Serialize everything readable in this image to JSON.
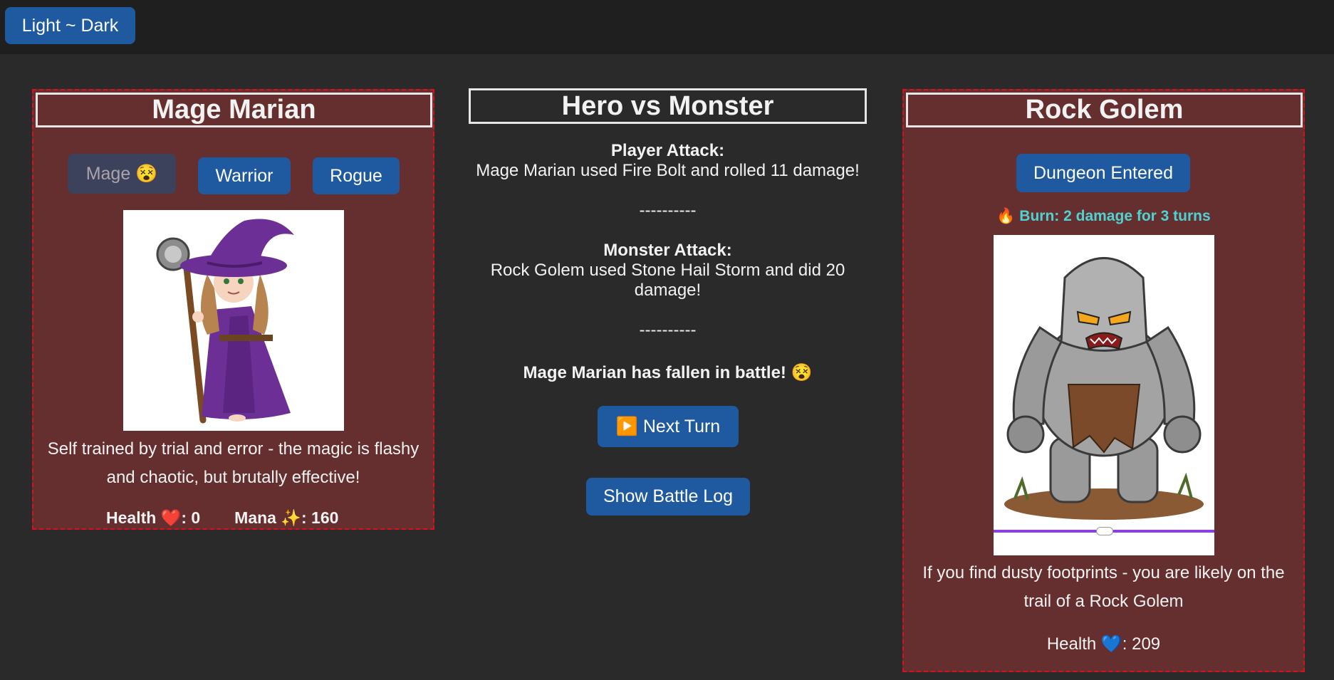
{
  "topbar": {
    "theme_toggle_label": "Light ~ Dark"
  },
  "hero": {
    "title": "Mage Marian",
    "class_buttons": [
      {
        "label": "Mage 😵",
        "selected": true
      },
      {
        "label": "Warrior",
        "selected": false
      },
      {
        "label": "Rogue",
        "selected": false
      }
    ],
    "description": "Self trained by trial and error - the magic is flashy and chaotic, but brutally effective!",
    "health_label": "Health ❤️: 0",
    "mana_label": "Mana ✨: 160"
  },
  "battle": {
    "title": "Hero vs Monster",
    "player_attack_heading": "Player Attack:",
    "player_attack_text": "Mage Marian used Fire Bolt and rolled 11 damage!",
    "divider": "----------",
    "monster_attack_heading": "Monster Attack:",
    "monster_attack_text": "Rock Golem used Stone Hail Storm and did 20 damage!",
    "fallen_message": "Mage Marian has fallen in battle! 😵",
    "next_turn_label": "▶️ Next Turn",
    "battle_log_label": "Show Battle Log"
  },
  "monster": {
    "title": "Rock Golem",
    "dungeon_button_label": "Dungeon Entered",
    "burn_status": "🔥 Burn: 2 damage for 3 turns",
    "description": "If you find dusty footprints - you are likely on the trail of a Rock Golem",
    "health_label": "Health 💙: 209"
  },
  "colors": {
    "background": "#2a2a2a",
    "card_background": "#652f30",
    "card_border": "#e00d1d",
    "button": "#1f5aa0",
    "burn_text": "#4fd3d2",
    "slider_track": "#8a3fe0"
  }
}
